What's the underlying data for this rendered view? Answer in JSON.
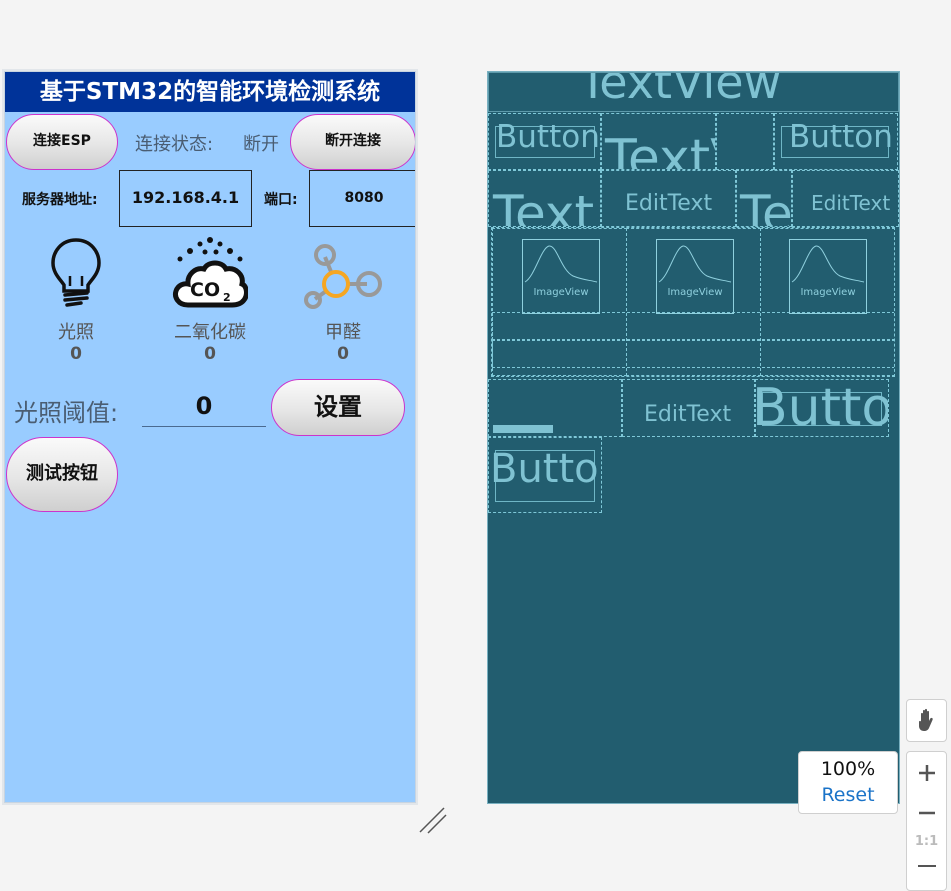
{
  "app": {
    "title": "基于STM32的智能环境检测系统",
    "connect_button": "连接ESP",
    "status_label": "连接状态:",
    "status_value": "断开",
    "disconnect_button": "断开连接",
    "server_label": "服务器地址:",
    "server_value": "192.168.4.1",
    "port_label": "端口:",
    "port_value": "8080",
    "sensors": [
      {
        "icon": "lightbulb-icon",
        "label": "光照",
        "value": "0"
      },
      {
        "icon": "co2-cloud-icon",
        "label": "二氧化碳",
        "value": "0"
      },
      {
        "icon": "molecule-icon",
        "label": "甲醛",
        "value": "0"
      }
    ],
    "threshold_label": "光照阈值:",
    "threshold_value": "0",
    "set_button": "设置",
    "test_button": "测试按钮"
  },
  "blueprint": {
    "title_view": "TextView",
    "button_left": "Button",
    "button_right": "Button",
    "textview_mid": "TextV",
    "text_left": "Text",
    "edit_text_1": "EditText",
    "text_mid": "Te",
    "edit_text_2": "EditText",
    "image_view_1": "ImageView",
    "image_view_2": "ImageView",
    "image_view_3": "ImageView",
    "edit_text_3": "EditText",
    "button_set": "Button",
    "button_test": "Button"
  },
  "zoom": {
    "level": "100%",
    "reset": "Reset",
    "one_to_one": "1:1"
  },
  "colors": {
    "title_bar": "#003399",
    "app_background": "#99ccff",
    "button_border": "#cc33cc",
    "blueprint_background": "#225d6f",
    "blueprint_line": "#7fc8d8",
    "reset_link": "#1a73c8"
  }
}
